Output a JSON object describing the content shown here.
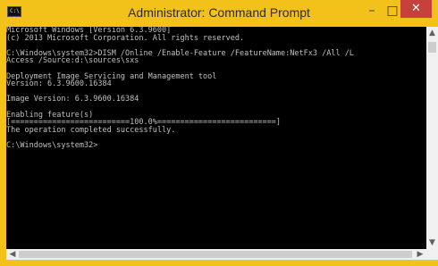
{
  "window": {
    "title": "Administrator: Command Prompt",
    "icon_text": "C:\\",
    "controls": {
      "minimize": "–",
      "maximize": "□",
      "close": "✕"
    }
  },
  "console": {
    "text": "Microsoft Windows [Version 6.3.9600]\n(c) 2013 Microsoft Corporation. All rights reserved.\n\nC:\\Windows\\system32>DISM /Online /Enable-Feature /FeatureName:NetFx3 /All /L\nAccess /Source:d:\\sources\\sxs\n\nDeployment Image Servicing and Management tool\nVersion: 6.3.9600.16384\n\nImage Version: 6.3.9600.16384\n\nEnabling feature(s)\n[==========================100.0%==========================]\nThe operation completed successfully.\n\nC:\\Windows\\system32>"
  },
  "scrollbars": {
    "up": "▲",
    "down": "▼",
    "left": "◀",
    "right": "▶"
  }
}
